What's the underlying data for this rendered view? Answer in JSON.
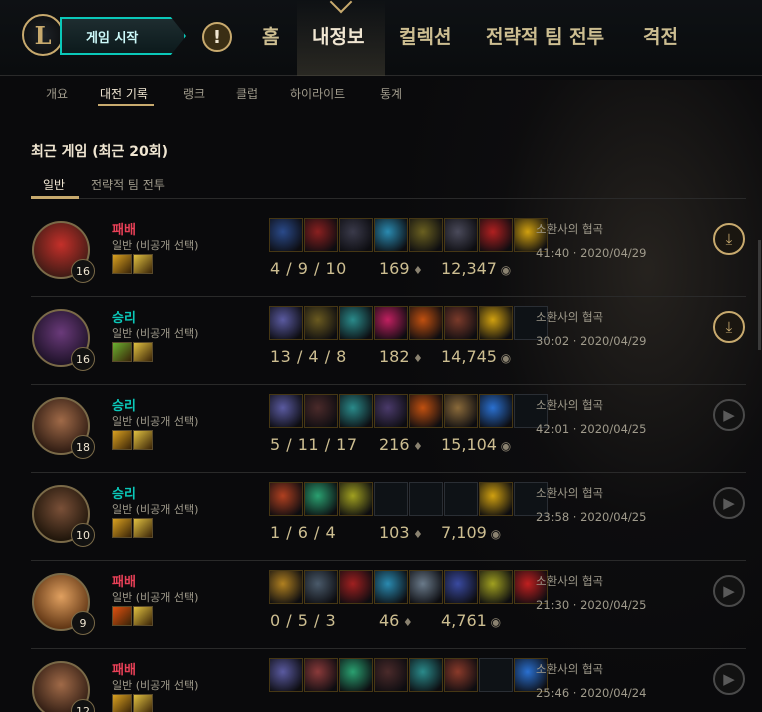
{
  "nav": {
    "play_label": "게임 시작",
    "tabs": [
      "홈",
      "내정보",
      "컬렉션",
      "전략적 팀 전투",
      "격전"
    ]
  },
  "subnav": [
    "개요",
    "대전 기록",
    "랭크",
    "클럽",
    "하이라이트",
    "통계"
  ],
  "section_title": "최근 게임 (최근 20회)",
  "filter_tabs": [
    "일반",
    "전략적 팀 전투"
  ],
  "matches": [
    {
      "result": "패배",
      "mode": "일반 (비공개 선택)",
      "level": "16",
      "kda": "4 / 9 / 10",
      "cs": "169",
      "gold": "12,347",
      "map": "소환사의 협곡",
      "time": "41:40 · 2020/04/29",
      "action": "download",
      "portrait": [
        "#c4302a",
        "#3a1a14"
      ],
      "spells": [
        "#d9a020",
        "#e0c040"
      ],
      "items": [
        "#2a4a8a",
        "#8a2020",
        "#3a3a4a",
        "#2a8ab0",
        "#6a6020",
        "#4a4a5a",
        "#b02020",
        "#d0a010"
      ]
    },
    {
      "result": "승리",
      "mode": "일반 (비공개 선택)",
      "level": "16",
      "kda": "13 / 4 / 8",
      "cs": "182",
      "gold": "14,745",
      "map": "소환사의 협곡",
      "time": "30:02 · 2020/04/29",
      "action": "download",
      "portrait": [
        "#6a3a7a",
        "#1a1024"
      ],
      "spells": [
        "#6ab030",
        "#e0c040"
      ],
      "items": [
        "#5a5aa0",
        "#6a5a20",
        "#2a8a8a",
        "#c02060",
        "#c05010",
        "#7a3a2a",
        "#d0a010",
        null
      ]
    },
    {
      "result": "승리",
      "mode": "일반 (비공개 선택)",
      "level": "18",
      "kda": "5 / 11 / 17",
      "cs": "216",
      "gold": "15,104",
      "map": "소환사의 협곡",
      "time": "42:01 · 2020/04/25",
      "action": "replay",
      "portrait": [
        "#a06a48",
        "#2a1810"
      ],
      "spells": [
        "#d9a020",
        "#e0c040"
      ],
      "items": [
        "#5a5aa0",
        "#4a2a2a",
        "#2a8a8a",
        "#4a3a6a",
        "#c05010",
        "#8a6a3a",
        "#2a70d0",
        null
      ]
    },
    {
      "result": "승리",
      "mode": "일반 (비공개 선택)",
      "level": "10",
      "kda": "1 / 6 / 4",
      "cs": "103",
      "gold": "7,109",
      "map": "소환사의 협곡",
      "time": "23:58 · 2020/04/25",
      "action": "replay",
      "portrait": [
        "#7a5038",
        "#1a1208"
      ],
      "spells": [
        "#d9a020",
        "#e0c040"
      ],
      "items": [
        "#b04020",
        "#2aa070",
        "#a0a020",
        null,
        null,
        null,
        "#d0a010",
        null
      ]
    },
    {
      "result": "패배",
      "mode": "일반 (비공개 선택)",
      "level": "9",
      "kda": "0 / 5 / 3",
      "cs": "46",
      "gold": "4,761",
      "map": "소환사의 협곡",
      "time": "21:30 · 2020/04/25",
      "action": "replay",
      "portrait": [
        "#e0a060",
        "#5a3010"
      ],
      "spells": [
        "#e05010",
        "#e0c040"
      ],
      "items": [
        "#b08020",
        "#4a5a6a",
        "#a02020",
        "#2a8ab0",
        "#6a7a8a",
        "#3a4aa0",
        "#a0a020",
        "#c02020"
      ]
    },
    {
      "result": "패배",
      "mode": "일반 (비공개 선택)",
      "level": "12",
      "kda": "",
      "cs": "",
      "gold": "",
      "map": "소환사의 협곡",
      "time": "25:46 · 2020/04/24",
      "action": "replay",
      "portrait": [
        "#a06a48",
        "#2a1810"
      ],
      "spells": [
        "#d9a020",
        "#e0c040"
      ],
      "items": [
        "#5a5aa0",
        "#8a3a3a",
        "#2aa070",
        "#4a2a2a",
        "#2a8a8a",
        "#8a3a2a",
        null,
        "#2a70d0"
      ]
    }
  ]
}
